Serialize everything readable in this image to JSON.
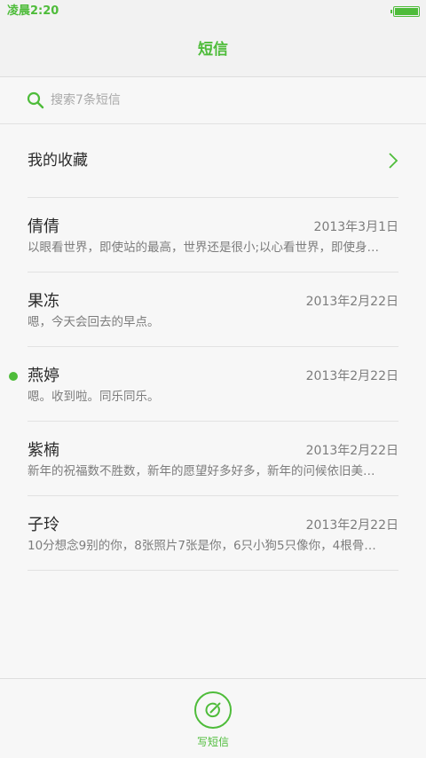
{
  "status_bar": {
    "time": "凌晨2:20"
  },
  "header": {
    "title": "短信"
  },
  "search": {
    "placeholder": "搜索7条短信"
  },
  "favorites": {
    "label": "我的收藏"
  },
  "conversations": [
    {
      "name": "倩倩",
      "date": "2013年3月1日",
      "preview": "以眼看世界，即使站的最高，世界还是很小;以心看世界，即使身…",
      "unread": false
    },
    {
      "name": "果冻",
      "date": "2013年2月22日",
      "preview": "嗯，今天会回去的早点。",
      "unread": false
    },
    {
      "name": "燕婷",
      "date": "2013年2月22日",
      "preview": "嗯。收到啦。同乐同乐。",
      "unread": true
    },
    {
      "name": "紫楠",
      "date": "2013年2月22日",
      "preview": "新年的祝福数不胜数，新年的愿望好多好多，新年的问候依旧美…",
      "unread": false
    },
    {
      "name": "子玲",
      "date": "2013年2月22日",
      "preview": "10分想念9别的你，8张照片7张是你，6只小狗5只像你，4根骨…",
      "unread": false
    }
  ],
  "compose": {
    "label": "写短信"
  },
  "icons": {
    "search": "search-icon",
    "chevron": "chevron-right-icon",
    "compose": "compose-icon",
    "battery": "battery-icon",
    "unread": "unread-dot-icon"
  },
  "colors": {
    "accent": "#4ebc3a",
    "text": "#2a2a2a",
    "secondary_text": "#7c7c7c",
    "background": "#f7f7f7"
  }
}
